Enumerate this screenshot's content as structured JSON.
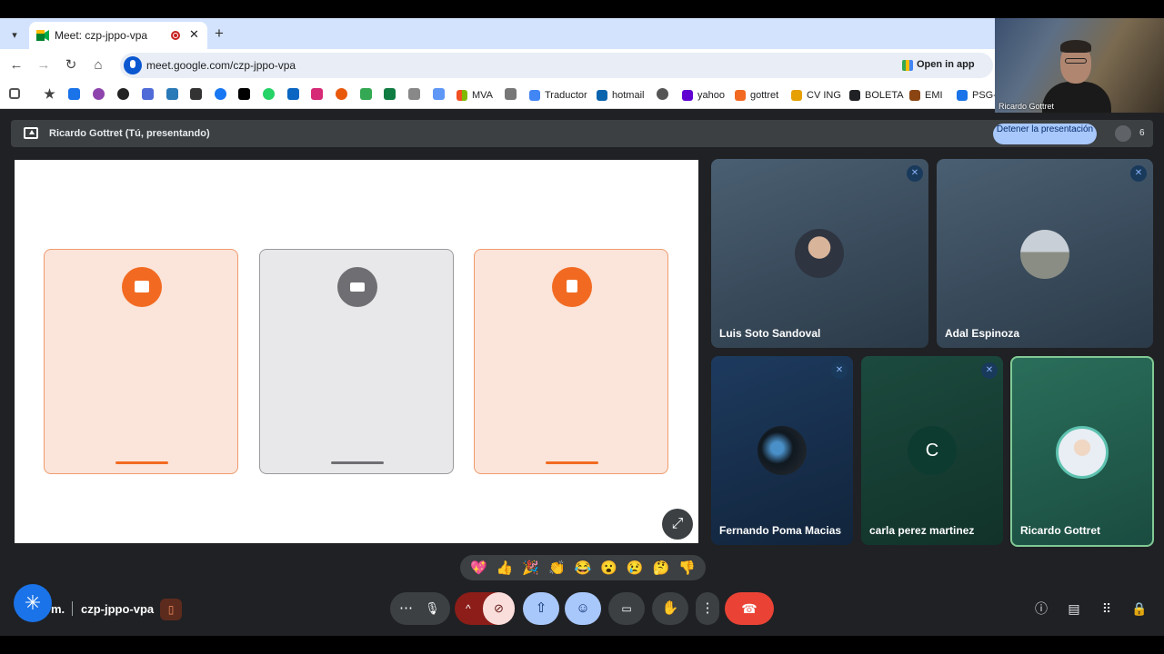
{
  "browser": {
    "tab_title": "Meet: czp-jppo-vpa",
    "close_glyph": "✕",
    "new_tab_glyph": "+",
    "url": "meet.google.com/czp-jppo-vpa",
    "open_in_app": "Open in app",
    "nav": {
      "back": "←",
      "forward": "→",
      "reload": "↻",
      "home": "⌂"
    },
    "bookmarks": [
      {
        "label": "MVA",
        "color": "#f25022"
      },
      {
        "label": "Traductor",
        "color": "#4285f4"
      },
      {
        "label": "hotmail",
        "color": "#0a64ad"
      },
      {
        "label": "yahoo",
        "color": "#6001d2"
      },
      {
        "label": "gottret",
        "color": "#f26a21"
      },
      {
        "label": "CV ING",
        "color": "#e6a000"
      },
      {
        "label": "BOLETA",
        "color": "#202124"
      },
      {
        "label": "EMI",
        "color": "#8b4513"
      },
      {
        "label": "PSG-",
        "color": "#1a73e8"
      }
    ]
  },
  "self_view": {
    "label": "Ricardo Gottret"
  },
  "presenting": {
    "text": "Ricardo Gottret (Tú, presentando)",
    "stop_button": "Detener la presentación",
    "participant_count": "6"
  },
  "slide": {
    "cards": [
      {
        "style": "orange",
        "icon": "image-icon"
      },
      {
        "style": "gray",
        "icon": "mail-icon"
      },
      {
        "style": "orange",
        "icon": "clipboard-check-icon"
      }
    ],
    "expand_glyph": "⤢"
  },
  "participants": [
    {
      "name": "Luis Soto Sandoval",
      "muted": true
    },
    {
      "name": "Adal Espinoza",
      "muted": true
    },
    {
      "name": "Fernando Poma Macias",
      "muted": true
    },
    {
      "name": "carla perez martinez",
      "muted": true,
      "initial": "C"
    },
    {
      "name": "Ricardo Gottret",
      "muted": false
    }
  ],
  "reactions": [
    "💖",
    "👍",
    "🎉",
    "👏",
    "😂",
    "😮",
    "😢",
    "🤔",
    "👎"
  ],
  "bottom": {
    "gemini_glyph": "✳",
    "gemini_trail": "m.",
    "meeting_code": "czp-jppo-vpa",
    "more_glyph": "⋯",
    "mic_glyph": "🎙",
    "caret_glyph": "^",
    "hangup_glyph": "☎"
  },
  "colors": {
    "accent": "#a8c7fa",
    "brand_orange": "#f26a21",
    "danger": "#ea4335"
  }
}
